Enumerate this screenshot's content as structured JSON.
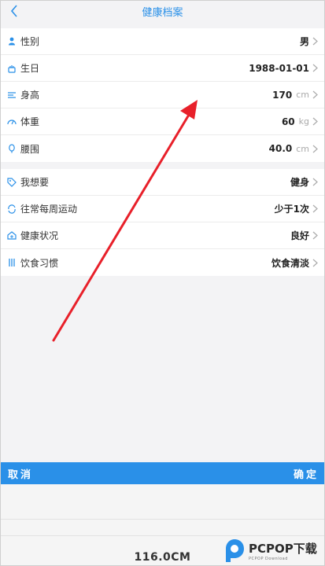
{
  "header": {
    "title": "健康档案"
  },
  "profile": [
    {
      "label": "性别",
      "value": "男",
      "unit": "",
      "icon": "person-icon"
    },
    {
      "label": "生日",
      "value": "1988-01-01",
      "unit": "",
      "icon": "cake-icon"
    },
    {
      "label": "身高",
      "value": "170",
      "unit": "cm",
      "icon": "height-icon"
    },
    {
      "label": "体重",
      "value": "60",
      "unit": "kg",
      "icon": "scale-icon"
    },
    {
      "label": "腰围",
      "value": "40.0",
      "unit": "cm",
      "icon": "waist-icon"
    }
  ],
  "preferences": [
    {
      "label": "我想要",
      "value": "健身",
      "icon": "tag-icon"
    },
    {
      "label": "往常每周运动",
      "value": "少于1次",
      "icon": "cycle-icon"
    },
    {
      "label": "健康状况",
      "value": "良好",
      "icon": "health-icon"
    },
    {
      "label": "饮食习惯",
      "value": "饮食清淡",
      "icon": "utensils-icon"
    }
  ],
  "picker": {
    "cancel": "取消",
    "confirm": "确定",
    "value": "116.0CM"
  },
  "watermark": {
    "brand": "PCPOP下载",
    "sub": "PCPOP Download"
  },
  "colors": {
    "accent": "#2a90e8",
    "arrow": "#e8202a"
  }
}
